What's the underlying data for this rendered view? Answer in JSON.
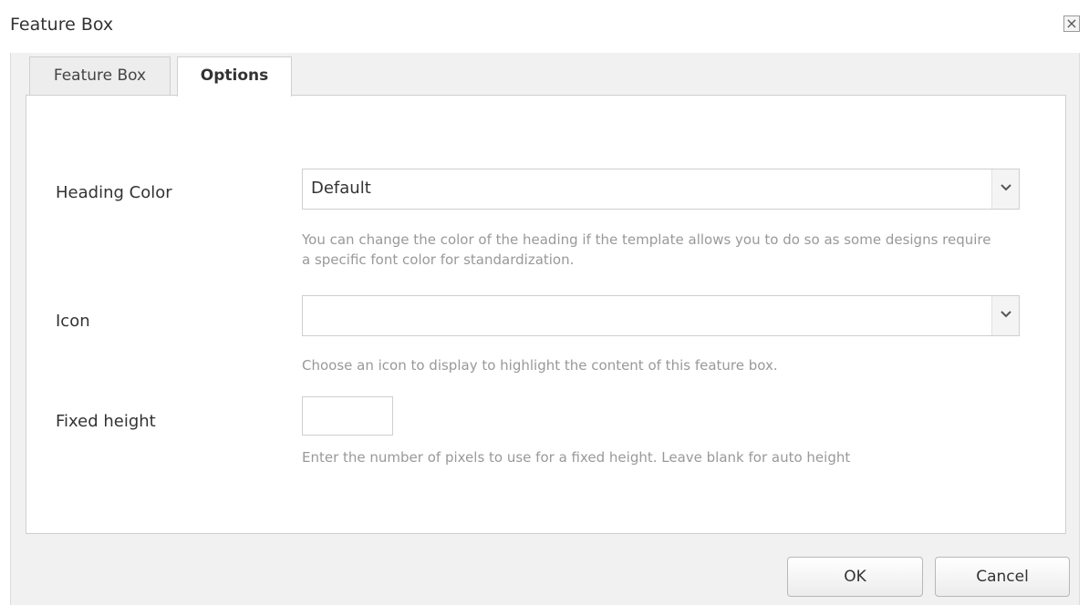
{
  "dialog": {
    "title": "Feature Box",
    "close_symbol": "×"
  },
  "tabs": [
    {
      "label": "Feature Box",
      "active": false
    },
    {
      "label": "Options",
      "active": true
    }
  ],
  "fields": {
    "heading_color": {
      "label": "Heading Color",
      "value": "Default",
      "help": "You can change the color of the heading if the template allows you to do so as some designs require a specific font color for standardization."
    },
    "icon": {
      "label": "Icon",
      "value": "",
      "help": "Choose an icon to display to highlight the content of this feature box."
    },
    "fixed_height": {
      "label": "Fixed height",
      "value": "",
      "help": "Enter the number of pixels to use for a fixed height. Leave blank for auto height"
    }
  },
  "buttons": {
    "ok": "OK",
    "cancel": "Cancel"
  },
  "colors": {
    "panel_bg": "#f1f1f1",
    "help_text": "#999999",
    "border": "#cfcfcf"
  }
}
